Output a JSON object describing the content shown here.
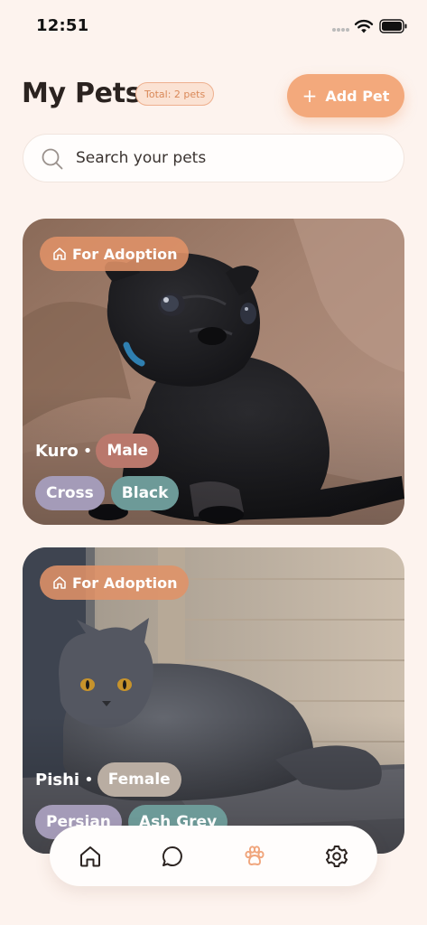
{
  "status_bar": {
    "time": "12:51"
  },
  "header": {
    "title": "My Pets",
    "total_badge": "Total: 2 pets",
    "add_button_label": "Add Pet",
    "add_button_icon": "plus-icon"
  },
  "search": {
    "placeholder": "Search your pets",
    "value": "",
    "icon": "search-icon"
  },
  "pets": [
    {
      "status": "For Adoption",
      "status_icon": "home-icon",
      "name": "Kuro",
      "gender": "Male",
      "breed": "Cross",
      "color": "Black",
      "photo": "black pug puppy sitting on brown couch"
    },
    {
      "status": "For Adoption",
      "status_icon": "home-icon",
      "name": "Pishi",
      "gender": "Female",
      "breed": "Persian",
      "color": "Ash Grey",
      "photo": "grey long-haired cat lying on floor"
    }
  ],
  "nav": {
    "items": [
      "home-icon",
      "chat-icon",
      "paw-icon",
      "settings-icon"
    ],
    "active": "paw-icon"
  },
  "colors": {
    "background": "#fdf3ee",
    "accent": "#f3a97c",
    "badge_text": "#d98858",
    "adoption_badge": "#e09268",
    "chip_male": "#b9786c",
    "chip_female": "#b9ada2",
    "chip_breed": "#a49bb8",
    "chip_color": "#6d9a98",
    "nav_active": "#f0a57c",
    "nav_inactive": "#2b2320"
  }
}
